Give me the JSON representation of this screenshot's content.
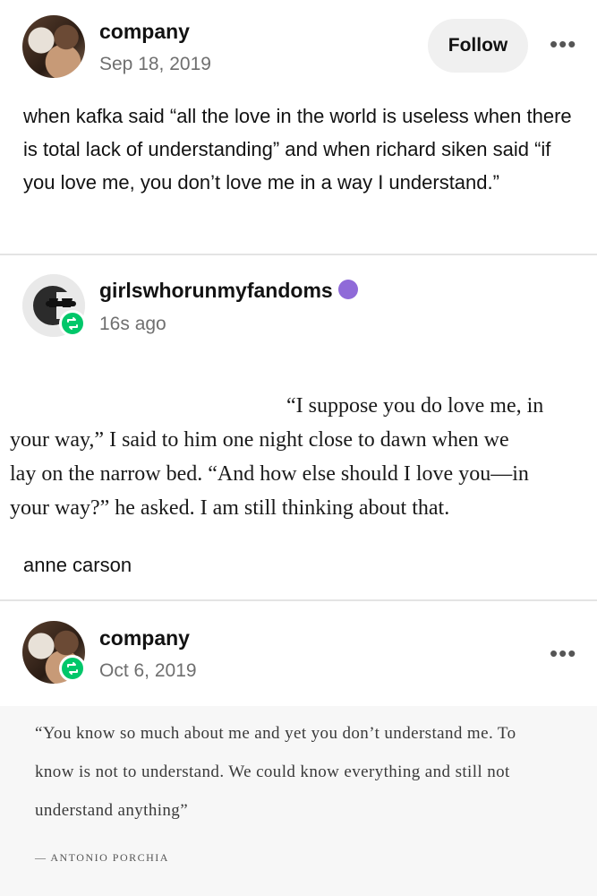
{
  "post1": {
    "blogname": "company",
    "date": "Sep 18, 2019",
    "follow_label": "Follow",
    "more": "•••",
    "text": "when kafka said “all the love in the world is useless when there is total lack of understanding” and when richard siken said “if you love me, you don’t love me in a way I understand.”"
  },
  "post2": {
    "blogname": "girlswhorunmyfandoms",
    "time": "16s ago",
    "quote_line1": "“I suppose you do love me, in",
    "quote_line2": "your way,” I said to him one night close to dawn when we",
    "quote_line3": "lay on the narrow bed. “And how else should I love you—in",
    "quote_line4": "your way?” he asked. I am still thinking about that.",
    "caption": "anne carson"
  },
  "post3": {
    "blogname": "company",
    "date": "Oct 6, 2019",
    "more": "•••",
    "quote_line1": "“You know so much about me and yet you don’t understand me. To",
    "quote_line2": "know is not to understand. We could know everything and still not",
    "quote_line3": "understand anything”",
    "attribution": "— ANTONIO PORCHIA"
  },
  "colors": {
    "reblog_green": "#00c76a",
    "meta_gray": "#6f6f6f",
    "follow_bg": "#f0f0f0",
    "badge_purple": "#8f6ad8"
  },
  "icons": {
    "reblog": "reblog-icon",
    "more": "more-icon",
    "community": "paw-icon"
  }
}
